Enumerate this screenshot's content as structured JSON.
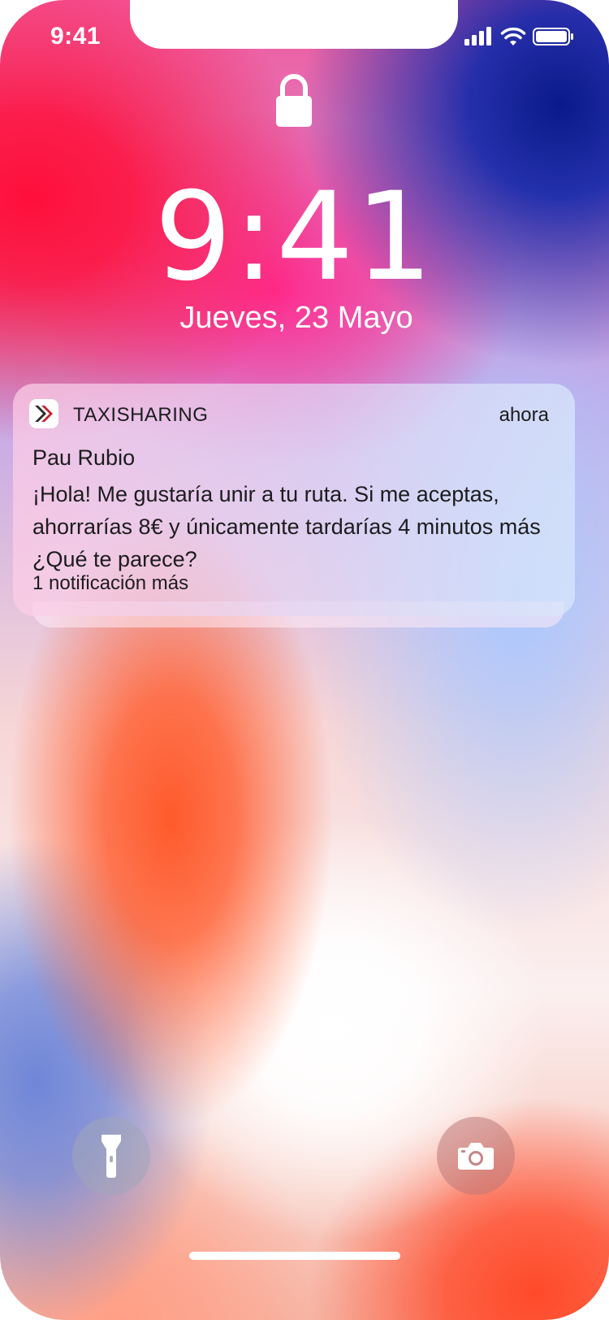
{
  "status_bar": {
    "time": "9:41",
    "icons": [
      "signal-icon",
      "wifi-icon",
      "battery-icon"
    ]
  },
  "lock_screen": {
    "lock_icon": "lock-icon",
    "time": "9:41",
    "date": "Jueves, 23 Mayo"
  },
  "notification": {
    "app_name": "TAXISHARING",
    "timestamp": "ahora",
    "title": "Pau Rubio",
    "body": "¡Hola! Me gustaría unir a tu ruta. Si me aceptas, ahorrarías 8€ y únicamente tardarías 4 minutos más ¿Qué te parece?",
    "more": "1 notificación más",
    "app_icon": "taxisharing-app-icon"
  },
  "quick_actions": {
    "flashlight_icon": "flashlight-icon",
    "camera_icon": "camera-icon"
  },
  "colors": {
    "text_primary": "#1c1c1e",
    "white": "#ffffff"
  }
}
